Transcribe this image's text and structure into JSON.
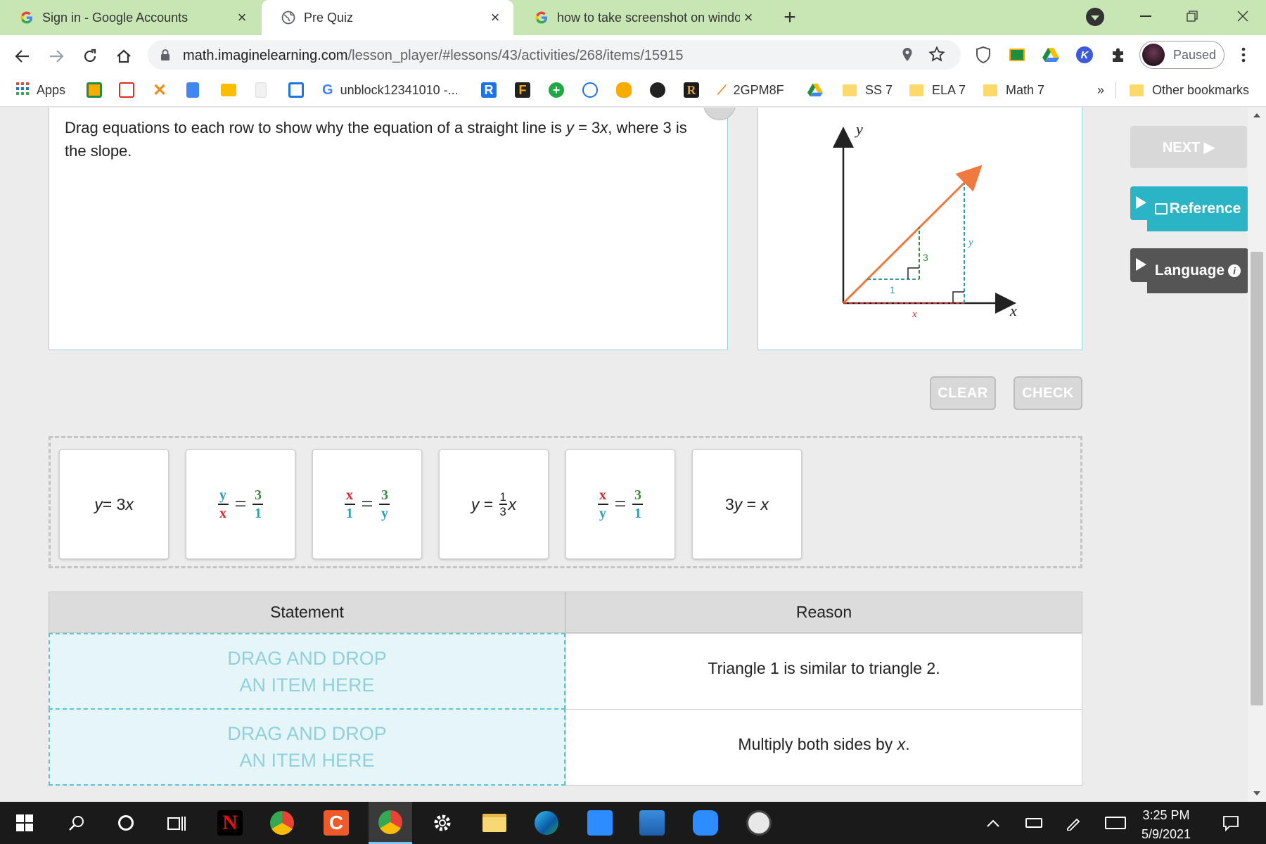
{
  "browser": {
    "tabs": [
      {
        "label": "Sign in - Google Accounts",
        "icon": "google-g-icon"
      },
      {
        "label": "Pre Quiz",
        "icon": "globe-icon"
      },
      {
        "label": "how to take screenshot on windo",
        "icon": "google-g-icon"
      }
    ],
    "active_tab": 1,
    "url_host": "math.imaginelearning.com",
    "url_path": "/lesson_player/#lessons/43/activities/268/items/15915",
    "profile_status": "Paused",
    "bookmarks": {
      "apps": "Apps",
      "unblock": "unblock12341010 -...",
      "code": "2GPM8F",
      "ss7": "SS 7",
      "ela7": "ELA 7",
      "math7": "Math 7",
      "more": "»",
      "other": "Other bookmarks"
    }
  },
  "question": {
    "text_before": "Drag equations to each row to show why the equation of a straight line is ",
    "eq_y": "y",
    "eq_mid": " = 3",
    "eq_x": "x",
    "text_after": ", where 3 is the slope."
  },
  "graph": {
    "y_axis": "y",
    "x_axis": "x",
    "small_run": "1",
    "small_rise": "3",
    "big_rise": "y",
    "big_run": "x"
  },
  "side_buttons": {
    "next": "NEXT ▶",
    "reference": "Reference",
    "language": "Language"
  },
  "actions": {
    "clear": "CLEAR",
    "check": "CHECK"
  },
  "cards": {
    "c1": {
      "a": "y",
      "b": " = 3",
      "c": "x"
    },
    "c2": {
      "num_l": "y",
      "den_l": "x",
      "eq": "=",
      "num_r": "3",
      "den_r": "1"
    },
    "c3": {
      "num_l": "x",
      "den_l": "1",
      "eq": "=",
      "num_r": "3",
      "den_r": "y"
    },
    "c4": {
      "a": "y",
      "b": " = ",
      "num": "1",
      "den": "3",
      "c": "x"
    },
    "c5": {
      "num_l": "x",
      "den_l": "y",
      "eq": "=",
      "num_r": "3",
      "den_r": "1"
    },
    "c6": {
      "a": "3",
      "b": "y",
      "c": " = ",
      "d": "x"
    }
  },
  "table": {
    "headers": [
      "Statement",
      "Reason"
    ],
    "drop_placeholder_line1": "DRAG AND DROP",
    "drop_placeholder_line2": "AN ITEM HERE",
    "reason1": "Triangle 1 is similar to triangle 2.",
    "reason2_a": "Multiply both sides by ",
    "reason2_b": "x",
    "reason2_c": "."
  },
  "taskbar": {
    "time": "3:25 PM",
    "date": "5/9/2021"
  },
  "colors": {
    "tabbar": "#c8e6b4",
    "reference": "#2bb3c6",
    "language": "#555555",
    "line": "#f07a3e",
    "red": "#d6282e",
    "teal": "#2a9fb3",
    "green": "#3b8b3b"
  }
}
